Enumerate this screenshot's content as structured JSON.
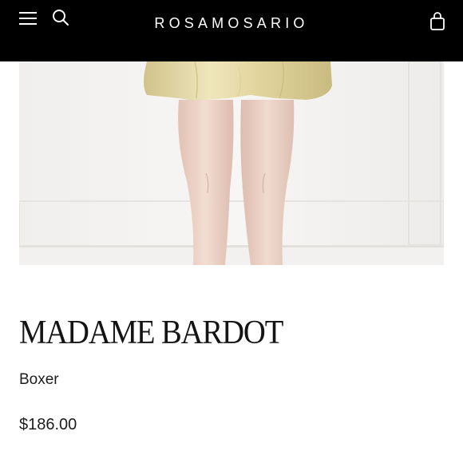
{
  "header": {
    "brand": "ROSAMOSARIO",
    "icons": {
      "menu": "hamburger-menu-icon",
      "search": "search-icon",
      "bag": "shopping-bag-icon"
    }
  },
  "product": {
    "title": "MADAME BARDOT",
    "subtitle": "Boxer",
    "price": "$186.00"
  },
  "colors": {
    "header_bg": "#000000",
    "header_fg": "#ffffff",
    "text": "#1a1a1a",
    "page_bg": "#ffffff",
    "silk_gold": "#e7dba6"
  }
}
